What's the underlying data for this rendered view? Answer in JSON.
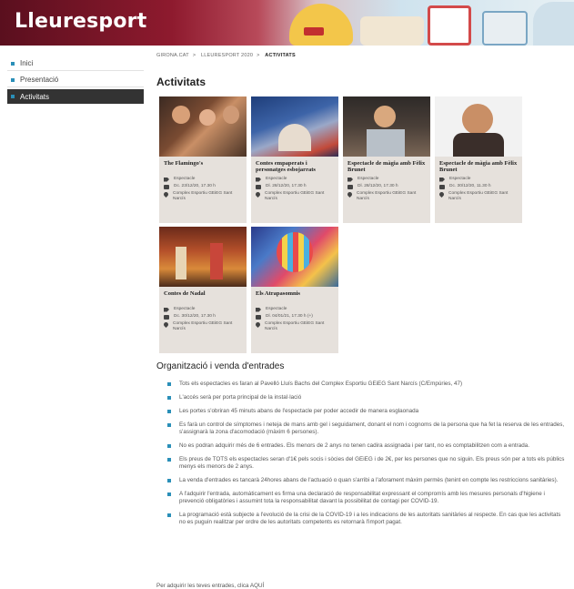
{
  "site": {
    "title": "Lleuresport"
  },
  "sidebar": {
    "items": [
      {
        "label": "Inici",
        "active": false
      },
      {
        "label": "Presentació",
        "active": false
      },
      {
        "label": "Activitats",
        "active": true
      }
    ]
  },
  "breadcrumb": [
    "GIRONA.CAT",
    "LLEURESPORT 2020",
    "ACTIVITATS"
  ],
  "page": {
    "title": "Activitats"
  },
  "cards": [
    {
      "title": "The Flamingo's",
      "category": "Espectacle",
      "date": "Dc. 23/12/20, 17.30 h",
      "venue": "Complex Esportiu GEiEG Sant Narcís"
    },
    {
      "title": "Contes empaperats i personatges esbojarrats",
      "category": "Espectacle",
      "date": "Dl. 28/12/20, 17.30 h",
      "venue": "Complex Esportiu GEiEG Sant Narcís"
    },
    {
      "title": "Espectacle de màgia amb Fèlix Brunet",
      "category": "Espectacle",
      "date": "Dl. 28/12/20, 17.30 h",
      "venue": "Complex Esportiu GEiEG Sant Narcís"
    },
    {
      "title": "Espectacle de màgia amb Fèlix Brunet",
      "category": "Espectacle",
      "date": "Dc. 30/12/20, 11.30 h",
      "venue": "Complex Esportiu GEiEG Sant Narcís"
    },
    {
      "title": "Contes de Nadal",
      "category": "Espectacle",
      "date": "Dc. 30/12/20, 17.30 h",
      "venue": "Complex Esportiu GEiEG Sant Narcís"
    },
    {
      "title": "Els Atrapasomnis",
      "category": "Espectacle",
      "date": "Dl. 04/01/21, 17.30 h (+)",
      "venue": "Complex Esportiu GEiEG Sant Narcís"
    }
  ],
  "organization": {
    "title": "Organització i venda d'entrades",
    "rules": [
      "Tots els espectacles es faran al Pavelló Lluís Bachs del Complex Esportiu GEiEG Sant Narcís (C/Empúries, 47)",
      "L'accés serà per porta principal de la instal·lació",
      "Les portes s'obriran 45 minuts abans de l'espectacle per poder accedir de manera esglaonada",
      "Es farà un control de símptomes i neteja de mans amb gel i seguidament, donant el nom i cognoms de la persona que ha fet la reserva de les entrades, s'assignarà la zona d'acomodació (màxim 6 persones).",
      "No es podran adquirir més de 6 entrades. Els menors de 2 anys no tenen cadira assignada i per tant, no es comptabilitzen com a entrada.",
      "Els preus de TOTS els espectacles seran d'1€ pels socis i sòcies del GEiEG i de 2€, per les persones que no siguin. Els preus són per a tots els públics menys els menors de 2 anys.",
      "La venda d'entrades es tancarà 24hores abans de l'actuació o quan s'arribi a l'aforament màxim permès (tenint en compte les restriccions sanitàries).",
      "A l'adquirir l'entrada, automàticament es firma una declaració de responsabilitat expressant el compromís amb les mesures personals d'higiene i prevenció obligatòries i assumint tota la responsabilitat davant la possibilitat de contagi per COVID-19.",
      "La programació està subjecte a l'evolució de la crisi de la COVID-19 i a les indicacions de les autoritats sanitàries al respecte. En cas que les activitats no es puguin realitzar per ordre de les autoritats competents es retornarà l'import pagat."
    ]
  },
  "footer": {
    "text": "Per adquirir les teves entrades, clica AQUÍ"
  },
  "colors": {
    "accent": "#2a8fb8",
    "banner": "#8e1a2e",
    "card_bg": "#e6e1dc"
  }
}
